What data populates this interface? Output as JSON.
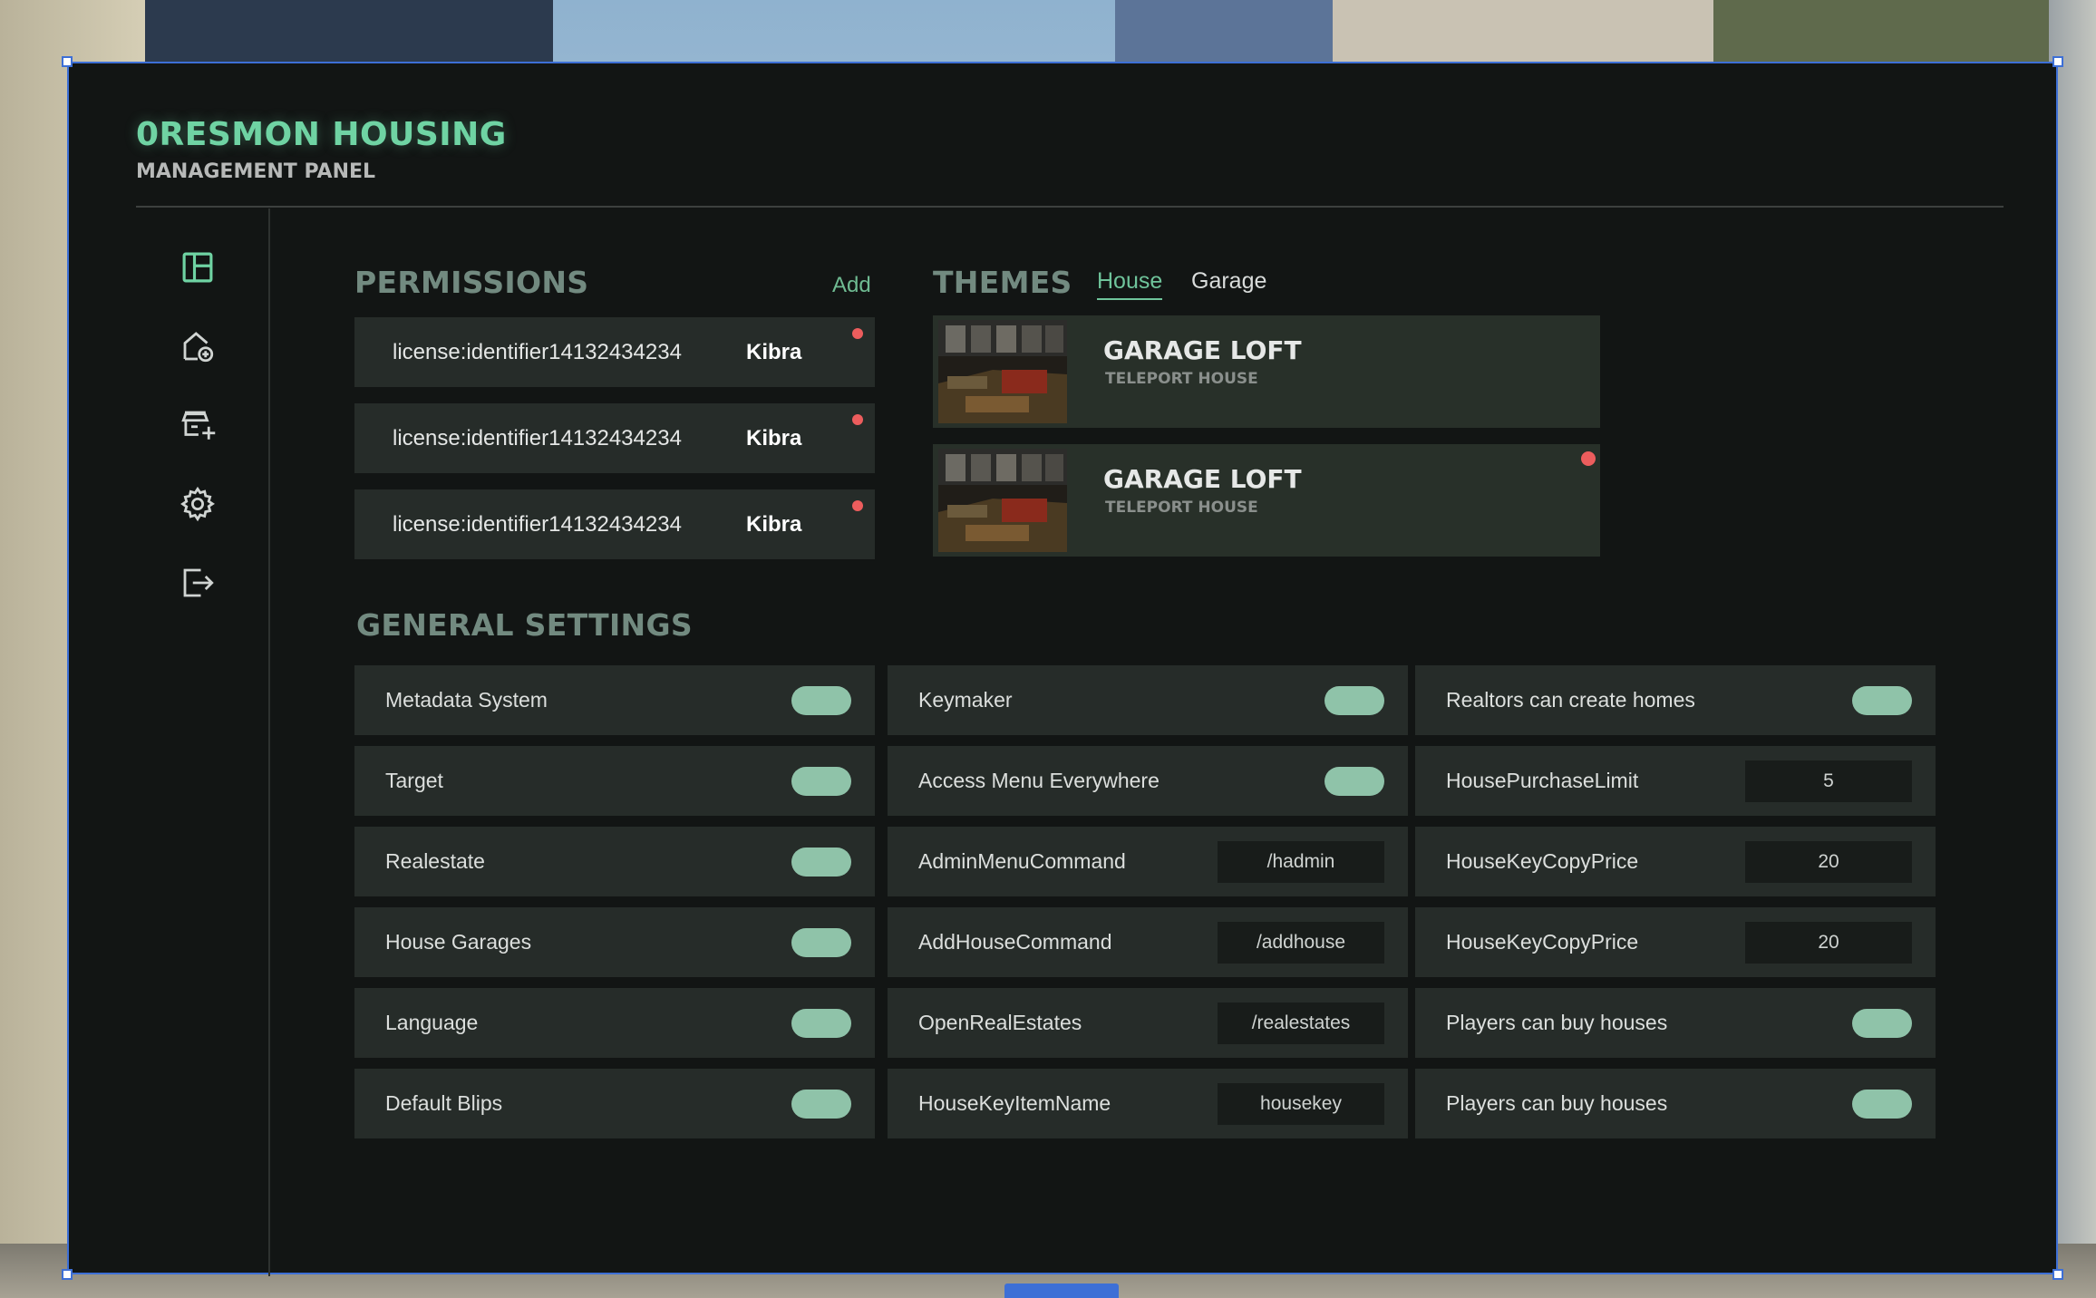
{
  "app": {
    "brand": "0RESMON HOUSING",
    "subtitle": "MANAGEMENT PANEL"
  },
  "sidebar": {
    "items": [
      {
        "name": "dashboard-icon"
      },
      {
        "name": "house-add-icon"
      },
      {
        "name": "store-add-icon"
      },
      {
        "name": "gear-icon"
      },
      {
        "name": "logout-icon"
      }
    ]
  },
  "permissions": {
    "title": "PERMISSIONS",
    "add_label": "Add",
    "rows": [
      {
        "identifier": "license:identifier14132434234",
        "name": "Kibra"
      },
      {
        "identifier": "license:identifier14132434234",
        "name": "Kibra"
      },
      {
        "identifier": "license:identifier14132434234",
        "name": "Kibra"
      }
    ]
  },
  "themes": {
    "title": "THEMES",
    "tabs": [
      {
        "label": "House",
        "active": true
      },
      {
        "label": "Garage",
        "active": false
      }
    ],
    "cards": [
      {
        "title": "GARAGE LOFT",
        "subtitle": "TELEPORT HOUSE",
        "marked": false
      },
      {
        "title": "GARAGE LOFT",
        "subtitle": "TELEPORT HOUSE",
        "marked": true
      }
    ]
  },
  "general_settings": {
    "title": "GENERAL SETTINGS",
    "columns": [
      [
        {
          "label": "Metadata System",
          "type": "toggle",
          "on": true
        },
        {
          "label": "Target",
          "type": "toggle",
          "on": true
        },
        {
          "label": "Realestate",
          "type": "toggle",
          "on": true
        },
        {
          "label": "House Garages",
          "type": "toggle",
          "on": true
        },
        {
          "label": "Language",
          "type": "toggle",
          "on": true
        },
        {
          "label": "Default Blips",
          "type": "toggle",
          "on": true
        }
      ],
      [
        {
          "label": "Keymaker",
          "type": "toggle",
          "on": true
        },
        {
          "label": "Access Menu Everywhere",
          "type": "toggle",
          "on": true
        },
        {
          "label": "AdminMenuCommand",
          "type": "field",
          "value": "/hadmin"
        },
        {
          "label": "AddHouseCommand",
          "type": "field",
          "value": "/addhouse"
        },
        {
          "label": "OpenRealEstates",
          "type": "field",
          "value": "/realestates"
        },
        {
          "label": "HouseKeyItemName",
          "type": "field",
          "value": "housekey"
        }
      ],
      [
        {
          "label": "Realtors can create homes",
          "type": "toggle",
          "on": true
        },
        {
          "label": "HousePurchaseLimit",
          "type": "field",
          "value": "5"
        },
        {
          "label": "HouseKeyCopyPrice",
          "type": "field",
          "value": "20"
        },
        {
          "label": "HouseKeyCopyPrice",
          "type": "field",
          "value": "20"
        },
        {
          "label": "Players can buy houses",
          "type": "toggle",
          "on": true
        },
        {
          "label": "Players can buy houses",
          "type": "toggle",
          "on": true
        }
      ]
    ]
  },
  "colors": {
    "accent": "#6fd3a3",
    "toggle_on": "#8fc3a9",
    "panel_bg": "#121514",
    "row_bg": "#262c29",
    "alert_dot": "#ec5d5d"
  }
}
